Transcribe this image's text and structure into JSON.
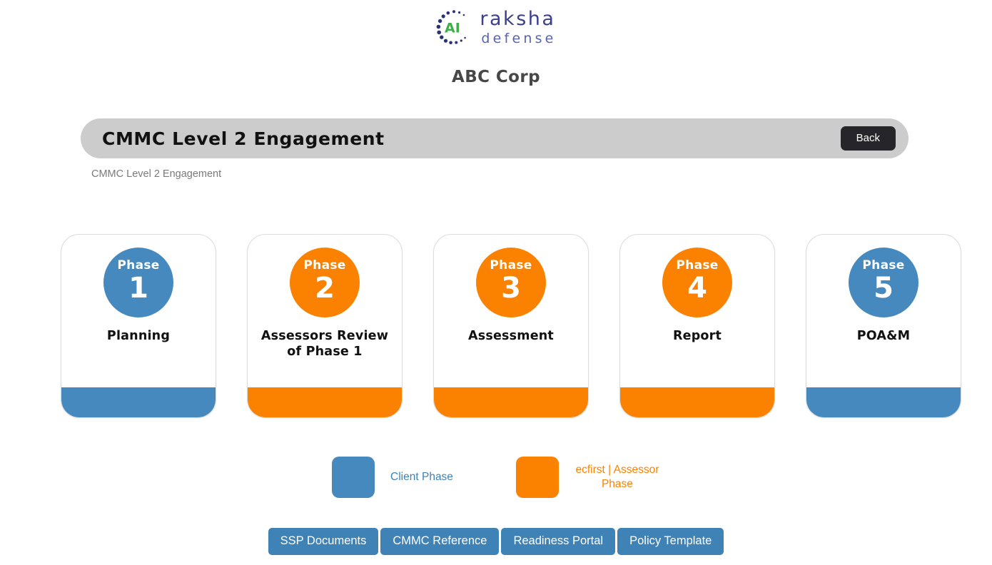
{
  "brand": {
    "logo_icon": "ai-circle-dots-icon",
    "logo_word_1": "raksha",
    "logo_word_2": "defense",
    "logo_monogram": "AI",
    "logo_green": "#3fae49",
    "logo_navy": "#2b3276",
    "org_name": "ABC Corp"
  },
  "header": {
    "title": "CMMC Level 2 Engagement",
    "back_label": "Back",
    "subtitle": "CMMC Level 2 Engagement",
    "bar_color": "#cccccc",
    "back_color": "#26262a"
  },
  "colors": {
    "client_blue": "#4689bf",
    "assessor_orange": "#fb8200",
    "button_blue": "#3f82b6"
  },
  "phases": [
    {
      "phase_word": "Phase",
      "number": "1",
      "label": "Planning",
      "color": "#4689bf",
      "owner": "client"
    },
    {
      "phase_word": "Phase",
      "number": "2",
      "label": "Assessors Review of Phase 1",
      "color": "#fb8200",
      "owner": "assessor"
    },
    {
      "phase_word": "Phase",
      "number": "3",
      "label": "Assessment",
      "color": "#fb8200",
      "owner": "assessor"
    },
    {
      "phase_word": "Phase",
      "number": "4",
      "label": "Report",
      "color": "#fb8200",
      "owner": "assessor"
    },
    {
      "phase_word": "Phase",
      "number": "5",
      "label": "POA&M",
      "color": "#4689bf",
      "owner": "client"
    }
  ],
  "legend": [
    {
      "label": "Client Phase",
      "color": "#4689bf",
      "text_color": "#3f82b6",
      "two_line": false
    },
    {
      "label": "ecfirst | Assessor Phase",
      "color": "#fb8200",
      "text_color": "#fb8200",
      "two_line": true
    }
  ],
  "footer_buttons": [
    {
      "label": "SSP Documents"
    },
    {
      "label": "CMMC Reference"
    },
    {
      "label": "Readiness Portal"
    },
    {
      "label": "Policy Template"
    }
  ]
}
